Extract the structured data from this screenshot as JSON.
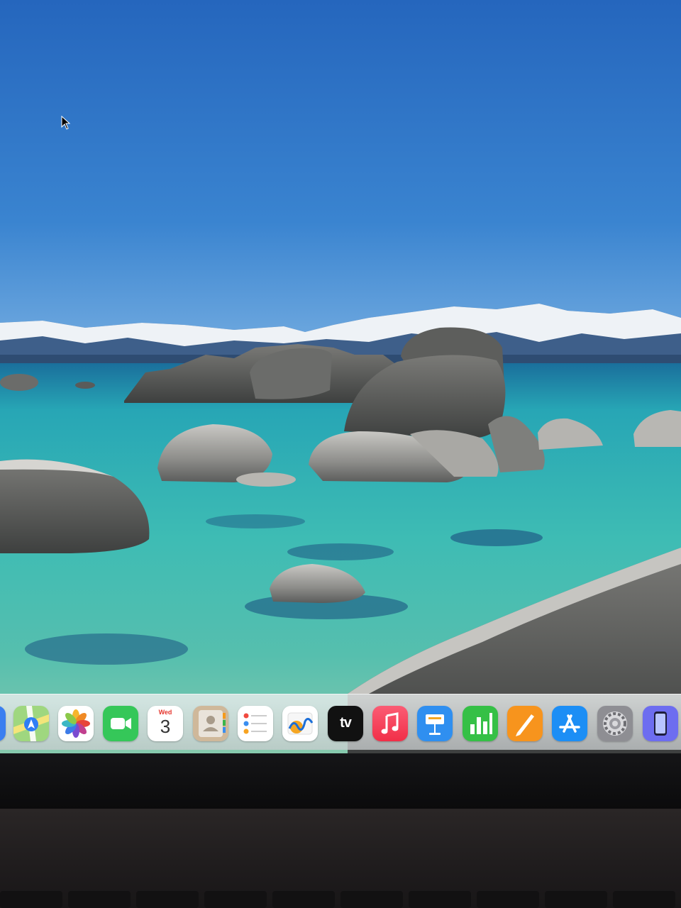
{
  "desktop": {
    "wallpaper": "lake-tahoe-boulders",
    "cursor": "arrow-pointer-icon"
  },
  "dock": {
    "apps": [
      {
        "name": "maps",
        "icon": "maps-icon"
      },
      {
        "name": "photos",
        "icon": "photos-icon"
      },
      {
        "name": "facetime",
        "icon": "facetime-icon"
      },
      {
        "name": "calendar",
        "icon": "calendar-icon",
        "day": "Wed",
        "date": "3"
      },
      {
        "name": "contacts",
        "icon": "contacts-icon"
      },
      {
        "name": "reminders",
        "icon": "reminders-icon"
      },
      {
        "name": "freeform",
        "icon": "freeform-icon"
      },
      {
        "name": "apple-tv",
        "icon": "apple-tv-icon",
        "label": "tv"
      },
      {
        "name": "music",
        "icon": "music-icon"
      },
      {
        "name": "keynote",
        "icon": "keynote-icon"
      },
      {
        "name": "numbers",
        "icon": "numbers-icon"
      },
      {
        "name": "pages",
        "icon": "pages-icon"
      },
      {
        "name": "app-store",
        "icon": "app-store-icon"
      },
      {
        "name": "system-settings",
        "icon": "system-settings-icon"
      },
      {
        "name": "iphone-mirroring",
        "icon": "iphone-mirroring-icon"
      }
    ]
  },
  "colors": {
    "sky": "#2f6fc0",
    "water": "#3ab6b8",
    "dock": "#e4e7e7"
  }
}
